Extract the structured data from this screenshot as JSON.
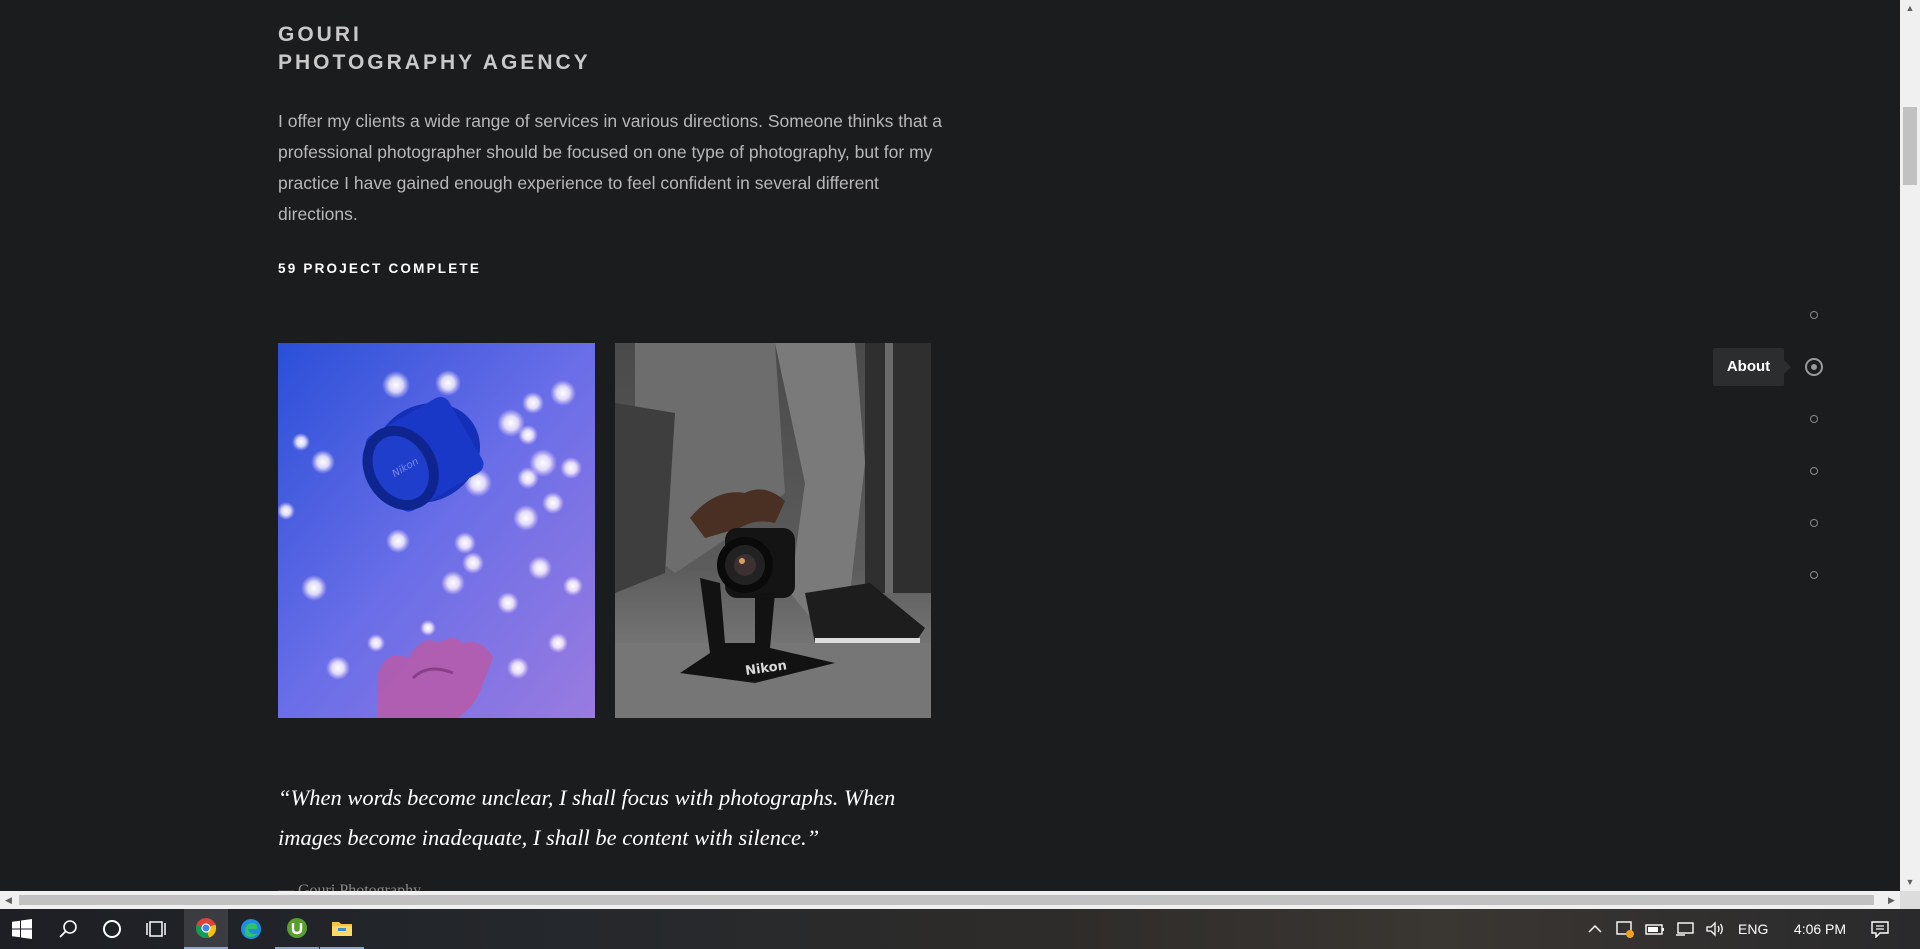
{
  "page": {
    "brand_line1": "GOURI",
    "brand_line2": "PHOTOGRAPHY AGENCY",
    "intro": "I offer my clients a wide range of services in various directions. Someone thinks that a professional photographer should be focused on one type of photography, but for my practice I have gained enough experience to feel confident in several different directions.",
    "projects_label": "59 PROJECT COMPLETE",
    "quote": "“When words become unclear, I shall focus with photographs. When images become inadequate, I shall be content with silence.”",
    "quote_author": "— Gouri Photography"
  },
  "photos": [
    {
      "subject": "camera-lens-bokeh-photo",
      "lens_text": "Nikon"
    },
    {
      "subject": "hand-holding-camera-photo",
      "stand_text": "Nikon"
    }
  ],
  "side_nav": {
    "active_tooltip": "About",
    "dot_count": 6,
    "active_index": 1
  },
  "taskbar": {
    "apps": [
      "start-icon",
      "search-icon",
      "cortana-icon",
      "task-view-icon",
      "chrome-icon",
      "edge-icon",
      "utorrent-icon",
      "file-explorer-icon"
    ],
    "active_app": "chrome-icon",
    "tray": {
      "language": "ENG",
      "time": "4:06 PM"
    }
  },
  "colors": {
    "page_bg": "#1b1c1e",
    "heading": "#c9c9c9",
    "body_text": "#b8b8b8",
    "accent_white": "#ffffff"
  }
}
